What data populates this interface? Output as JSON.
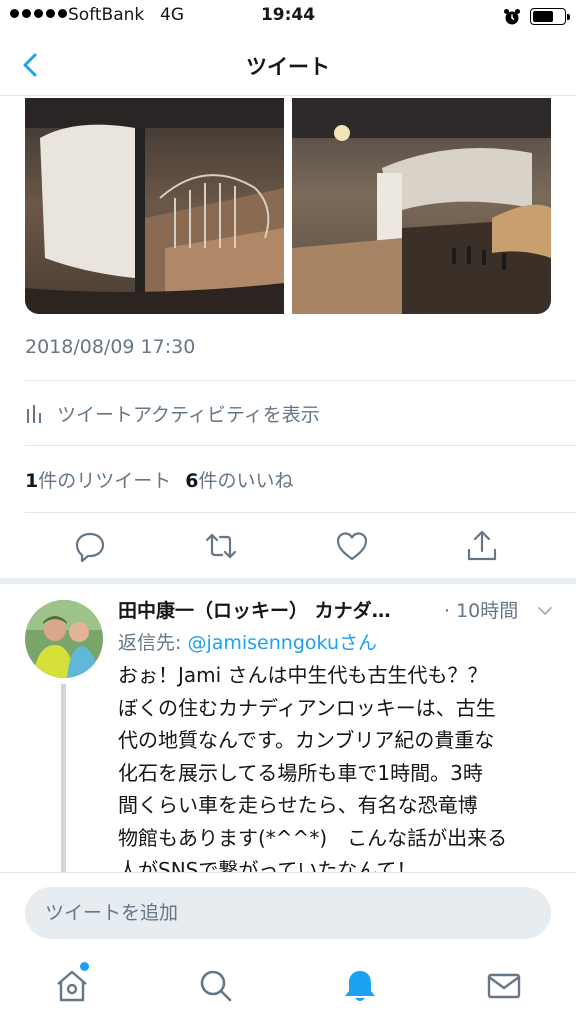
{
  "status_bar": {
    "carrier": "SoftBank",
    "network": "4G",
    "time": "19:44",
    "battery_level": 0.7,
    "signal_bars": 5
  },
  "nav": {
    "title": "ツイート",
    "back_icon": "chevron-left-icon"
  },
  "tweet": {
    "images": [
      "dinosaur-museum-photo-1",
      "dinosaur-museum-photo-2"
    ],
    "timestamp": "2018/08/09 17:30",
    "activity_label": "ツイートアクティビティを表示",
    "retweet_count": "1",
    "retweet_label": "件のリツイート",
    "like_count": "6",
    "like_label": "件のいいね",
    "actions": [
      "reply-icon",
      "retweet-icon",
      "like-icon",
      "share-icon"
    ]
  },
  "reply": {
    "name": "田中康一（ロッキー） カナダ…",
    "time": "· 10時間",
    "reply_to_label": "返信先: ",
    "reply_to_handle": "@jamisenngoku",
    "reply_to_suffix": "さん",
    "text_lines": [
      "おぉ！Jami さんは中生代も古生代も？？",
      "ぼくの住むカナディアンロッキーは、古生",
      "代の地質なんです。カンブリア紀の貴重な",
      "化石を展示してる場所も車で1時間。3時",
      "間くらい車を走らせたら、有名な恐竜博",
      "物館もあります(*^^*)　こんな話が出来る",
      "人がSNSで繋がっていたなんて！"
    ]
  },
  "compose": {
    "placeholder": "ツイートを追加"
  },
  "tab_bar": {
    "tabs": [
      "home-icon",
      "search-icon",
      "notifications-icon",
      "messages-icon"
    ],
    "active_tab": "notifications-icon"
  },
  "colors": {
    "accent": "#1da1f2",
    "secondary_text": "#657786",
    "divider": "#e1e8ed"
  }
}
